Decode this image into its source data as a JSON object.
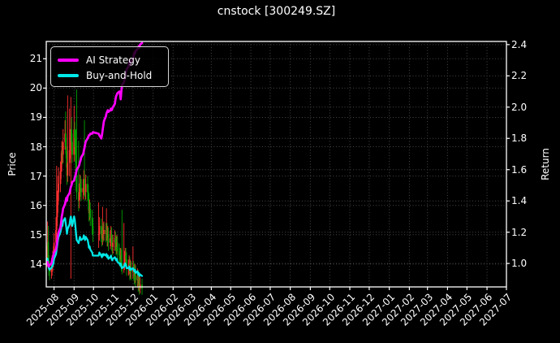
{
  "chart": {
    "title": "cnstock [300249.SZ]",
    "ylabel_left": "Price",
    "ylabel_right": "Return",
    "legend": [
      {
        "label": "AI Strategy",
        "color": "#ff00ff"
      },
      {
        "label": "Buy-and-Hold",
        "color": "#00e8e8"
      }
    ]
  },
  "chart_data": {
    "type": "candlestick+line",
    "title": "cnstock [300249.SZ]",
    "colors": {
      "up_candle": "#ff3030",
      "down_candle": "#00a000",
      "strategy_line": "#ff00ff",
      "buyhold_line": "#00e8e8",
      "grid": "#464646",
      "axis": "#ffffff",
      "text": "#ffffff",
      "background": "#000000"
    },
    "axes": {
      "x_range": [
        "2025-07-20",
        "2027-07-01"
      ],
      "x_ticks": [
        "2025-08",
        "2025-09",
        "2025-10",
        "2025-11",
        "2025-12",
        "2026-01",
        "2026-02",
        "2026-03",
        "2026-04",
        "2026-05",
        "2026-06",
        "2026-07",
        "2026-08",
        "2026-09",
        "2026-10",
        "2026-11",
        "2026-12",
        "2027-01",
        "2027-02",
        "2027-03",
        "2027-04",
        "2027-05",
        "2027-06",
        "2027-07"
      ],
      "price_ticks": [
        14,
        15,
        16,
        17,
        18,
        19,
        20,
        21
      ],
      "price_lim": [
        13.22,
        21.59
      ],
      "return_ticks": [
        1.0,
        1.2,
        1.4,
        1.6,
        1.8,
        2.0,
        2.2,
        2.4
      ],
      "return_lim": [
        0.85,
        2.42
      ],
      "grid": true,
      "legend_position": "upper left"
    },
    "candles": {
      "dates": [
        "2025-07-21",
        "2025-07-22",
        "2025-07-23",
        "2025-07-24",
        "2025-07-25",
        "2025-07-28",
        "2025-07-29",
        "2025-07-30",
        "2025-07-31",
        "2025-08-01",
        "2025-08-04",
        "2025-08-05",
        "2025-08-06",
        "2025-08-07",
        "2025-08-08",
        "2025-08-11",
        "2025-08-12",
        "2025-08-13",
        "2025-08-14",
        "2025-08-15",
        "2025-08-18",
        "2025-08-19",
        "2025-08-20",
        "2025-08-21",
        "2025-08-22",
        "2025-08-25",
        "2025-08-26",
        "2025-08-27",
        "2025-08-28",
        "2025-08-29",
        "2025-09-01",
        "2025-09-02",
        "2025-09-03",
        "2025-09-04",
        "2025-09-05",
        "2025-09-08",
        "2025-09-09",
        "2025-09-10",
        "2025-09-11",
        "2025-09-12",
        "2025-09-15",
        "2025-09-16",
        "2025-09-17",
        "2025-09-18",
        "2025-09-19",
        "2025-09-22",
        "2025-09-23",
        "2025-09-24",
        "2025-09-25",
        "2025-09-26",
        "2025-09-29",
        "2025-09-30",
        "2025-10-09",
        "2025-10-10",
        "2025-10-13",
        "2025-10-14",
        "2025-10-15",
        "2025-10-16",
        "2025-10-17",
        "2025-10-20",
        "2025-10-21",
        "2025-10-22",
        "2025-10-23",
        "2025-10-24",
        "2025-10-27",
        "2025-10-28",
        "2025-10-29",
        "2025-10-30",
        "2025-10-31",
        "2025-11-03",
        "2025-11-04",
        "2025-11-05",
        "2025-11-06",
        "2025-11-07",
        "2025-11-10",
        "2025-11-11",
        "2025-11-12",
        "2025-11-13",
        "2025-11-14",
        "2025-11-17",
        "2025-11-18",
        "2025-11-19",
        "2025-11-20",
        "2025-11-21",
        "2025-11-24",
        "2025-11-25",
        "2025-11-26",
        "2025-11-27",
        "2025-11-28",
        "2025-12-01",
        "2025-12-02",
        "2025-12-03",
        "2025-12-04",
        "2025-12-05",
        "2025-12-08",
        "2025-12-09",
        "2025-12-10",
        "2025-12-11",
        "2025-12-12",
        "2025-12-15"
      ],
      "open": [
        14.2,
        14.3,
        14.75,
        14.1,
        13.87,
        13.73,
        13.9,
        14.02,
        14.16,
        14.3,
        14.73,
        15.16,
        15.59,
        16.02,
        16.45,
        16.73,
        17.16,
        17.45,
        17.88,
        17.73,
        18.16,
        18.45,
        18.02,
        17.59,
        17.02,
        17.45,
        17.88,
        18.3,
        18.59,
        18.16,
        17.73,
        18.59,
        18.3,
        17.73,
        17.02,
        16.45,
        16.16,
        16.45,
        16.73,
        16.59,
        16.45,
        16.59,
        16.88,
        16.59,
        16.45,
        16.73,
        16.45,
        16.16,
        15.73,
        15.88,
        15.59,
        15.3,
        15.02,
        15.02,
        15.3,
        15.02,
        14.87,
        15.16,
        15.02,
        15.16,
        15.02,
        15.16,
        14.87,
        15.02,
        14.73,
        14.87,
        15.02,
        14.73,
        14.59,
        14.73,
        14.87,
        14.73,
        14.59,
        14.73,
        14.44,
        14.3,
        14.16,
        14.3,
        14.02,
        13.87,
        14.02,
        14.16,
        14.3,
        14.16,
        13.87,
        13.87,
        14.02,
        13.73,
        13.87,
        13.73,
        13.87,
        13.73,
        13.59,
        13.73,
        13.44,
        13.59,
        13.3,
        13.44,
        13.16,
        13.3
      ],
      "high": [
        14.6,
        15.45,
        15.3,
        14.3,
        14.1,
        14.2,
        14.3,
        14.45,
        14.6,
        15.05,
        15.6,
        17.35,
        16.5,
        17.0,
        17.3,
        17.5,
        17.8,
        18.2,
        18.15,
        18.6,
        18.9,
        19.2,
        18.3,
        17.85,
        19.75,
        19.3,
        18.6,
        19.7,
        19.0,
        18.45,
        19.4,
        18.85,
        18.55,
        18.6,
        19.95,
        18.2,
        16.75,
        17.05,
        17.0,
        16.9,
        16.9,
        17.2,
        18.9,
        16.9,
        17.05,
        17.0,
        16.7,
        16.4,
        16.2,
        16.1,
        15.85,
        15.55,
        16.1,
        15.6,
        15.55,
        15.25,
        15.95,
        15.4,
        15.45,
        15.4,
        15.9,
        15.4,
        15.3,
        15.25,
        15.15,
        15.3,
        15.25,
        15.0,
        15.0,
        15.15,
        15.1,
        14.95,
        15.0,
        14.95,
        14.7,
        14.55,
        14.55,
        14.5,
        15.85,
        15.4,
        14.45,
        14.55,
        14.55,
        14.4,
        14.15,
        14.3,
        14.25,
        14.15,
        14.1,
        14.6,
        14.1,
        14.0,
        14.0,
        13.95,
        13.85,
        13.8,
        13.7,
        13.65,
        13.55,
        13.5
      ],
      "low": [
        13.9,
        14.1,
        13.95,
        13.6,
        13.45,
        13.5,
        13.6,
        13.75,
        13.9,
        14.05,
        14.45,
        14.9,
        15.3,
        15.75,
        16.15,
        16.45,
        16.9,
        17.15,
        17.4,
        17.45,
        17.9,
        17.75,
        17.3,
        16.7,
        16.8,
        17.0,
        17.6,
        13.5,
        17.85,
        17.45,
        17.5,
        18.0,
        17.45,
        16.5,
        16.2,
        15.8,
        15.9,
        16.2,
        16.3,
        16.15,
        16.2,
        16.35,
        16.3,
        16.15,
        16.2,
        16.15,
        15.85,
        15.45,
        15.5,
        15.3,
        15.0,
        14.75,
        14.55,
        14.8,
        14.75,
        14.6,
        14.65,
        14.75,
        14.8,
        14.75,
        14.8,
        14.6,
        14.6,
        14.45,
        14.5,
        14.6,
        14.45,
        14.3,
        14.35,
        14.45,
        14.45,
        14.3,
        14.35,
        14.15,
        14.0,
        13.9,
        13.95,
        13.75,
        13.65,
        13.7,
        13.8,
        13.95,
        13.9,
        13.6,
        13.6,
        13.65,
        13.45,
        13.5,
        13.45,
        13.5,
        13.45,
        13.3,
        13.35,
        13.2,
        13.2,
        13.05,
        13.1,
        12.95,
        13.0,
        12.95
      ],
      "close": [
        14.3,
        14.75,
        14.1,
        13.87,
        13.73,
        13.9,
        14.02,
        14.16,
        14.3,
        14.73,
        15.16,
        15.59,
        16.02,
        16.45,
        16.73,
        17.16,
        17.45,
        17.88,
        17.73,
        18.16,
        18.45,
        18.02,
        17.59,
        17.02,
        17.45,
        17.88,
        18.3,
        18.59,
        18.16,
        17.73,
        18.59,
        18.3,
        17.73,
        17.02,
        16.45,
        16.16,
        16.45,
        16.73,
        16.59,
        16.45,
        16.59,
        16.88,
        16.59,
        16.45,
        16.73,
        16.45,
        16.16,
        15.73,
        15.88,
        15.59,
        15.3,
        15.02,
        15.02,
        15.3,
        15.02,
        14.87,
        15.16,
        15.02,
        15.16,
        15.02,
        15.16,
        14.87,
        15.02,
        14.73,
        14.87,
        15.02,
        14.73,
        14.59,
        14.73,
        14.87,
        14.73,
        14.59,
        14.73,
        14.44,
        14.3,
        14.16,
        14.3,
        14.02,
        13.87,
        14.02,
        14.16,
        14.3,
        14.16,
        13.87,
        13.87,
        14.02,
        13.73,
        13.87,
        13.73,
        13.87,
        13.73,
        13.59,
        13.73,
        13.44,
        13.59,
        13.3,
        13.44,
        13.16,
        13.3,
        13.16
      ]
    },
    "series": [
      {
        "name": "AI Strategy",
        "axis": "return",
        "values": [
          1.0,
          1.01,
          0.99,
          0.98,
          0.99,
          1.0,
          1.02,
          1.04,
          1.05,
          1.07,
          1.09,
          1.12,
          1.15,
          1.18,
          1.2,
          1.23,
          1.26,
          1.3,
          1.32,
          1.35,
          1.38,
          1.4,
          1.42,
          1.4,
          1.43,
          1.45,
          1.47,
          1.49,
          1.5,
          1.52,
          1.53,
          1.55,
          1.56,
          1.58,
          1.6,
          1.62,
          1.63,
          1.65,
          1.66,
          1.68,
          1.7,
          1.72,
          1.74,
          1.76,
          1.78,
          1.8,
          1.81,
          1.82,
          1.82,
          1.83,
          1.83,
          1.84,
          1.83,
          1.82,
          1.8,
          1.82,
          1.85,
          1.88,
          1.91,
          1.94,
          1.96,
          1.97,
          1.98,
          1.97,
          1.98,
          1.99,
          1.98,
          1.99,
          2.0,
          2.02,
          2.05,
          2.07,
          2.08,
          2.09,
          2.1,
          2.08,
          2.05,
          2.1,
          2.14,
          2.16,
          2.18,
          2.2,
          2.22,
          2.24,
          2.26,
          2.28,
          2.3,
          2.27,
          2.29,
          2.31,
          2.33,
          2.35,
          2.34,
          2.36,
          2.37,
          2.38,
          2.39,
          2.38,
          2.4,
          2.41
        ]
      },
      {
        "name": "Buy-and-Hold",
        "axis": "return",
        "values": [
          1.0,
          1.031,
          0.986,
          0.97,
          0.96,
          0.972,
          0.98,
          0.99,
          1.0,
          1.03,
          1.06,
          1.09,
          1.12,
          1.15,
          1.17,
          1.2,
          1.22,
          1.25,
          1.24,
          1.27,
          1.29,
          1.26,
          1.23,
          1.19,
          1.22,
          1.25,
          1.28,
          1.3,
          1.27,
          1.24,
          1.3,
          1.28,
          1.24,
          1.19,
          1.15,
          1.13,
          1.15,
          1.17,
          1.16,
          1.15,
          1.16,
          1.18,
          1.16,
          1.15,
          1.17,
          1.15,
          1.13,
          1.1,
          1.11,
          1.09,
          1.07,
          1.05,
          1.05,
          1.07,
          1.05,
          1.04,
          1.06,
          1.05,
          1.06,
          1.05,
          1.06,
          1.04,
          1.05,
          1.03,
          1.04,
          1.05,
          1.03,
          1.02,
          1.03,
          1.04,
          1.03,
          1.02,
          1.03,
          1.01,
          1.0,
          0.99,
          1.0,
          0.98,
          0.97,
          0.98,
          0.99,
          1.0,
          0.99,
          0.97,
          0.97,
          0.98,
          0.96,
          0.97,
          0.96,
          0.97,
          0.96,
          0.95,
          0.96,
          0.94,
          0.95,
          0.93,
          0.94,
          0.92,
          0.93,
          0.92
        ]
      }
    ]
  }
}
